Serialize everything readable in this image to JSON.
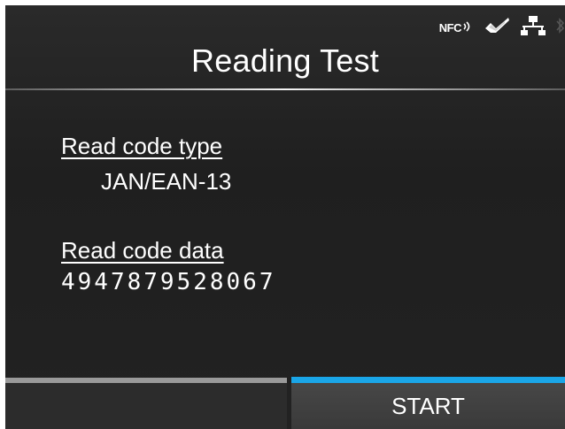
{
  "header": {
    "title": "Reading Test",
    "status_icons": {
      "nfc_label": "NFC",
      "icons": [
        "nfc-icon",
        "checkmark-tag-icon",
        "network-icon",
        "bluetooth-icon"
      ]
    }
  },
  "content": {
    "code_type_label": "Read code type",
    "code_type_value": "JAN/EAN-13",
    "code_data_label": "Read code data",
    "code_data_value": "4947879528067"
  },
  "softkeys": {
    "left_label": "",
    "right_label": "START"
  },
  "colors": {
    "accent": "#1aa6e8",
    "background": "#222222",
    "text": "#ffffff",
    "inactive_bar": "#9a9a9a"
  }
}
